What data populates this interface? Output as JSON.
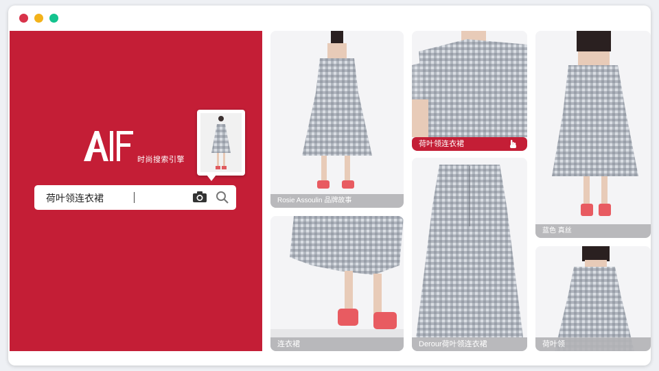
{
  "window": {
    "buttons": [
      "close",
      "minimize",
      "maximize"
    ]
  },
  "brand": {
    "logo_text": "AIF",
    "tagline": "时尚搜索引擎",
    "accent_color": "#c41e36"
  },
  "search": {
    "query": "荷叶领连衣裙",
    "camera_icon": "camera-icon",
    "search_icon": "search-icon"
  },
  "results": [
    {
      "caption": "Rosie Assoulin 品牌故事"
    },
    {
      "caption": "连衣裙"
    },
    {
      "caption": "荷叶领连衣裙",
      "highlight": true
    },
    {
      "caption": "Derour荷叶领连衣裙"
    },
    {
      "caption": "蓝色 真丝"
    },
    {
      "caption": "荷叶领"
    }
  ]
}
